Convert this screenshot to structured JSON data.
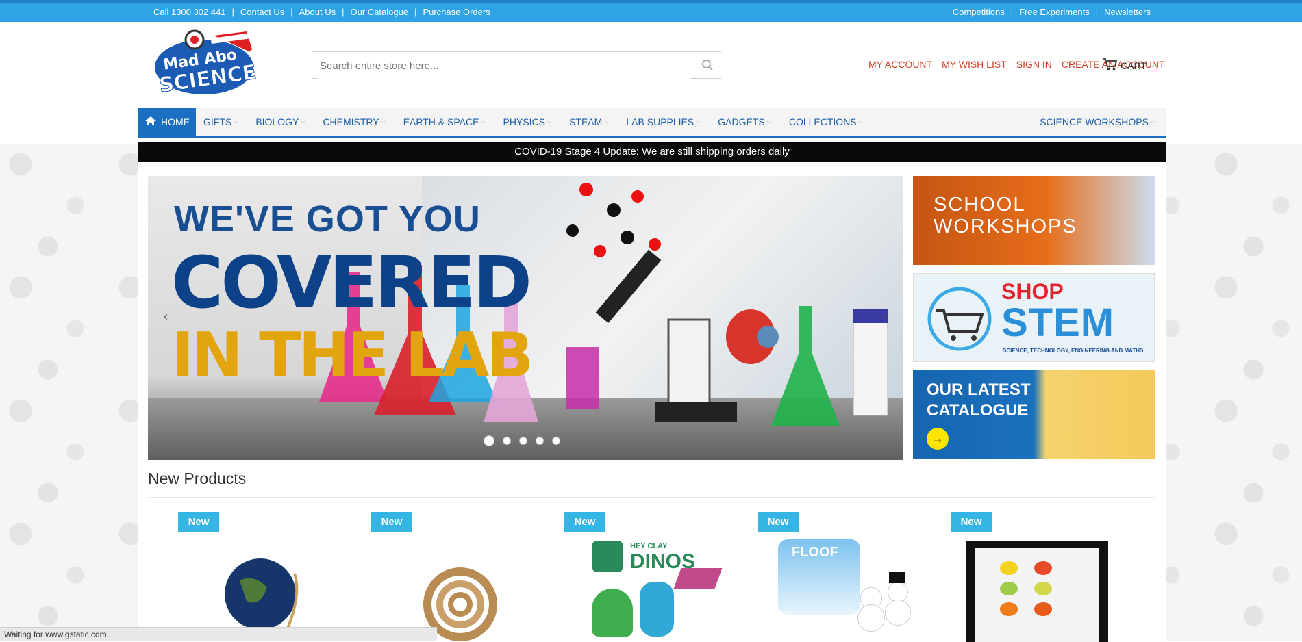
{
  "topbar": {
    "left_links": [
      "Call 1300 302 441",
      "Contact Us",
      "About Us",
      "Our Catalogue",
      "Purchase Orders"
    ],
    "right_links": [
      "Competitions",
      "Free Experiments",
      "Newsletters"
    ]
  },
  "header": {
    "logo_text": "Mad About SCIENCE",
    "search_placeholder": "Search entire store here...",
    "account_links": [
      "My Account",
      "My Wish List",
      "Sign In",
      "Create an Account"
    ],
    "cart_label": "CART"
  },
  "nav": {
    "home": "HOME",
    "items": [
      "GIFTS",
      "BIOLOGY",
      "CHEMISTRY",
      "EARTH & SPACE",
      "PHYSICS",
      "STEAM",
      "LAB SUPPLIES",
      "GADGETS",
      "COLLECTIONS"
    ],
    "right_item": "SCIENCE WORKSHOPS"
  },
  "notice": "COVID-19 Stage 4 Update: We are still shipping orders daily",
  "slider": {
    "line1": "WE'VE GOT YOU",
    "line2": "COVERED",
    "line3": "IN THE LAB",
    "slide_count": 5,
    "active_slide": 1
  },
  "promos": {
    "school": "SCHOOL WORKSHOPS",
    "stem_shop": "SHOP",
    "stem_word": "STEM",
    "stem_sub": "SCIENCE, TECHNOLOGY, ENGINEERING AND MATHS",
    "catalogue_line1": "OUR LATEST",
    "catalogue_line2": "CATALOGUE"
  },
  "section": {
    "title": "New Products"
  },
  "products": [
    {
      "badge": "New",
      "image": "globe-image"
    },
    {
      "badge": "New",
      "image": "tubing-coil-image"
    },
    {
      "badge": "New",
      "image": "hey-clay-dinos-image",
      "label_top": "HEY CLAY",
      "label_big": "DINOS"
    },
    {
      "badge": "New",
      "image": "floof-snowman-image",
      "label": "FLOOF"
    },
    {
      "badge": "New",
      "image": "butterfly-frame-image"
    }
  ],
  "status": "Waiting for www.gstatic.com..."
}
